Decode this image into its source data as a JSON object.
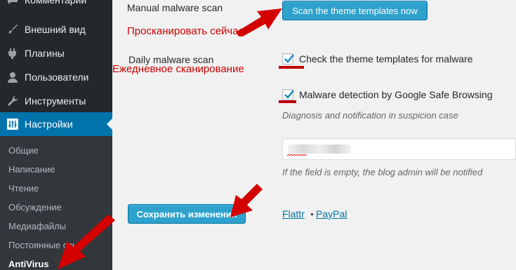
{
  "sidebar": {
    "menu": [
      {
        "label": "Комментарии",
        "icon": "comments-icon"
      },
      {
        "label": "Внешний вид",
        "icon": "paintbrush-icon"
      },
      {
        "label": "Плагины",
        "icon": "plugin-icon"
      },
      {
        "label": "Пользователи",
        "icon": "users-icon"
      },
      {
        "label": "Инструменты",
        "icon": "wrench-icon"
      },
      {
        "label": "Настройки",
        "icon": "settings-icon"
      }
    ],
    "submenu": [
      "Общие",
      "Написание",
      "Чтение",
      "Обсуждение",
      "Медиафайлы",
      "Постоянные ссылки",
      "AntiVirus"
    ]
  },
  "content": {
    "manual_scan_label": "Manual malware scan",
    "scan_button": "Scan the theme templates now",
    "daily_scan_label": "Daily malware scan",
    "check_templates_label": "Check the theme templates for malware",
    "google_label": "Malware detection by Google Safe Browsing",
    "diagnosis_hint": "Diagnosis and notification in suspicion case",
    "email_value": "",
    "email_hint": "If the field is empty, the blog admin will be notified",
    "save_button": "Сохранить изменения",
    "flattr": "Flattr",
    "separator": "•",
    "paypal": "PayPal"
  },
  "annotations": {
    "scan_now": "Просканировать сейчас",
    "daily_scan": "Ежедневное сканирование"
  },
  "colors": {
    "accent": "#0073aa",
    "button": "#2ea2cc",
    "annotation": "#cc0000",
    "sidebar": "#23282d"
  }
}
